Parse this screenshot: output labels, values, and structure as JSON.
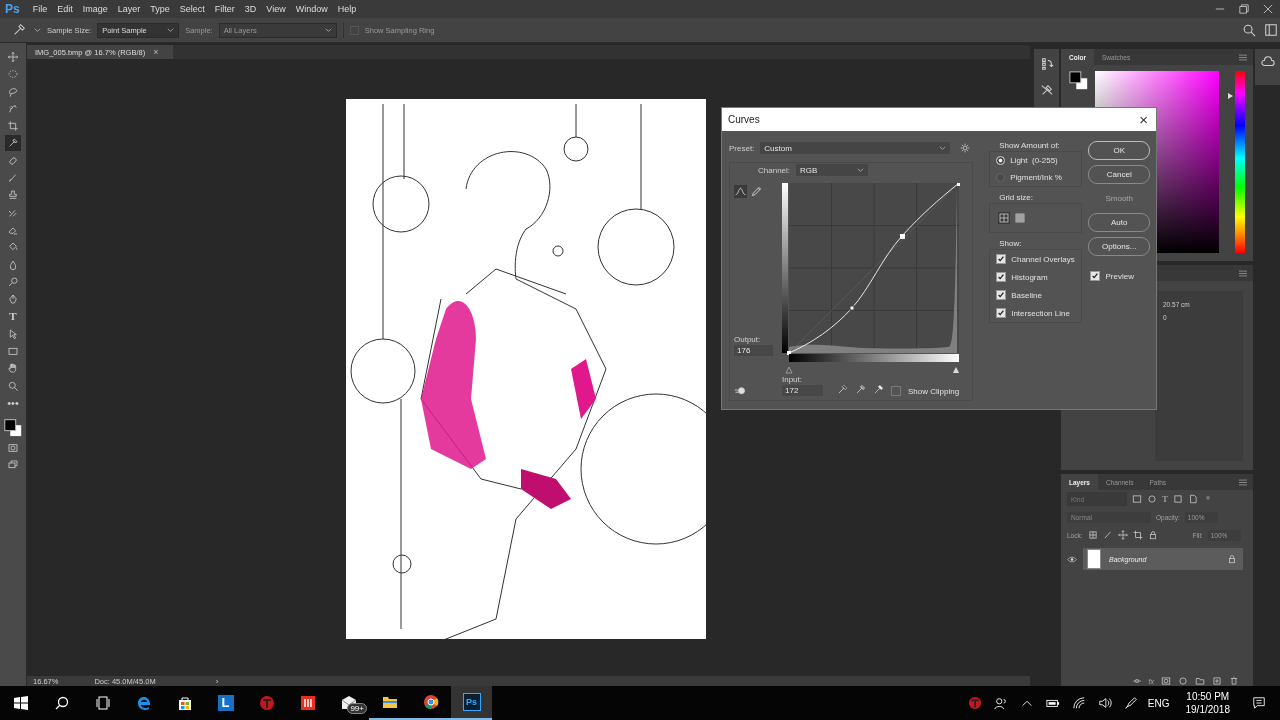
{
  "app": {
    "logo": "Ps"
  },
  "menu": [
    {
      "label": "File"
    },
    {
      "label": "Edit"
    },
    {
      "label": "Image"
    },
    {
      "label": "Layer"
    },
    {
      "label": "Type"
    },
    {
      "label": "Select"
    },
    {
      "label": "Filter"
    },
    {
      "label": "3D"
    },
    {
      "label": "View"
    },
    {
      "label": "Window"
    },
    {
      "label": "Help"
    }
  ],
  "options_bar": {
    "sample_size_label": "Sample Size:",
    "sample_size": "Point Sample",
    "sample_label": "Sample:",
    "sample": "All Layers",
    "sample_disabled": true,
    "show_sampling_ring": {
      "label": "Show Sampling Ring",
      "checked": false,
      "disabled": true
    }
  },
  "document_tab": {
    "title": "IMG_005.bmp @ 16.7% (RGB/8)",
    "close": "×"
  },
  "tools": [
    {
      "kind": "move",
      "selected": false
    },
    {
      "kind": "marquee",
      "selected": false
    },
    {
      "kind": "lasso",
      "selected": false
    },
    {
      "kind": "quick-select",
      "selected": false
    },
    {
      "kind": "crop",
      "selected": false
    },
    {
      "kind": "eyedropper",
      "selected": true
    },
    {
      "kind": "healing",
      "selected": false
    },
    {
      "kind": "brush",
      "selected": false
    },
    {
      "kind": "stamp",
      "selected": false
    },
    {
      "kind": "history-brush",
      "selected": false
    },
    {
      "kind": "eraser",
      "selected": false
    },
    {
      "kind": "bucket",
      "selected": false
    },
    {
      "kind": "blur",
      "selected": false
    },
    {
      "kind": "dodge",
      "selected": false
    },
    {
      "kind": "pen",
      "selected": false
    },
    {
      "kind": "type",
      "glyph": "T",
      "selected": false
    },
    {
      "kind": "path-select",
      "selected": false
    },
    {
      "kind": "rectangle",
      "selected": false
    },
    {
      "kind": "hand",
      "selected": false
    },
    {
      "kind": "zoom",
      "selected": false
    },
    {
      "kind": "more",
      "glyph": "•••",
      "selected": false
    }
  ],
  "status_bar": {
    "zoom": "16.67%",
    "doc": "Doc: 45.0M/45.0M",
    "arrow": "›"
  },
  "curves": {
    "title": "Curves",
    "close": "×",
    "preset_label": "Preset:",
    "preset": "Custom",
    "channel_label": "Channel:",
    "channel": "RGB",
    "curve_tools": [
      {
        "kind": "curve",
        "selected": true
      },
      {
        "kind": "pencil",
        "selected": false
      }
    ],
    "output_label": "Output:",
    "output": "176",
    "input_label": "Input:",
    "input": "172",
    "show_clipping": {
      "label": "Show Clipping",
      "checked": false
    },
    "show_amount": {
      "title": "Show Amount of:",
      "options": [
        {
          "label": "Light  (0-255)",
          "selected": true
        },
        {
          "label": "Pigment/Ink %",
          "selected": false
        }
      ]
    },
    "grid_size": {
      "title": "Grid size:",
      "options": [
        {
          "kind": "coarse",
          "selected": true
        },
        {
          "kind": "fine",
          "selected": false
        }
      ]
    },
    "show": {
      "title": "Show:",
      "items": [
        {
          "label": "Channel Overlays",
          "checked": true
        },
        {
          "label": "Histogram",
          "checked": true
        },
        {
          "label": "Baseline",
          "checked": true
        },
        {
          "label": "Intersection Line",
          "checked": true
        }
      ]
    },
    "buttons": [
      {
        "label": "OK",
        "disabled": false,
        "default": true
      },
      {
        "label": "Cancel",
        "disabled": false,
        "default": false
      },
      {
        "label": "Smooth",
        "disabled": true,
        "default": false
      },
      {
        "label": "Auto",
        "disabled": false,
        "default": false
      },
      {
        "label": "Options...",
        "disabled": false,
        "default": false
      }
    ],
    "preview": {
      "label": "Preview",
      "checked": true
    }
  },
  "color_panel": {
    "tabs": [
      {
        "label": "Color",
        "selected": true
      },
      {
        "label": "Swatches",
        "selected": false
      }
    ],
    "hue": {
      "level": 0.86
    }
  },
  "properties": {
    "values": [
      "20.57 cm",
      "0"
    ]
  },
  "layers_panel": {
    "tabs": [
      {
        "label": "Layers",
        "selected": true
      },
      {
        "label": "Channels",
        "selected": false
      },
      {
        "label": "Paths",
        "selected": false
      }
    ],
    "filter_placeholder": "Kind",
    "filter_type_glyph": "T",
    "blend_mode": "Normal",
    "opacity_label": "Opacity:",
    "opacity": "100%",
    "lock_label": "Lock:",
    "fill_label": "Fill:",
    "fill": "100%",
    "layers": [
      {
        "name": "Background",
        "visible": true,
        "locked": true,
        "selected": true
      }
    ],
    "footer_fx": "fx"
  },
  "taskbar": {
    "apps": [
      {
        "kind": "start",
        "running": false,
        "selected": false
      },
      {
        "kind": "search",
        "running": false,
        "selected": false
      },
      {
        "kind": "task-view",
        "running": false,
        "selected": false
      },
      {
        "kind": "edge",
        "running": false,
        "selected": false
      },
      {
        "kind": "store",
        "running": false,
        "selected": false
      },
      {
        "kind": "letter-app",
        "glyph": "L",
        "running": false,
        "selected": false
      },
      {
        "kind": "red-app",
        "running": false,
        "selected": false
      },
      {
        "kind": "bars-app",
        "running": false,
        "selected": false
      },
      {
        "kind": "mail",
        "badge": "99+",
        "running": false,
        "selected": false
      },
      {
        "kind": "folder",
        "running": true,
        "selected": false
      },
      {
        "kind": "chrome",
        "running": true,
        "selected": false
      },
      {
        "kind": "photoshop",
        "glyph": "Ps",
        "running": true,
        "selected": true
      }
    ],
    "language": "ENG",
    "time": "10:50 PM",
    "date": "19/1/2018"
  }
}
